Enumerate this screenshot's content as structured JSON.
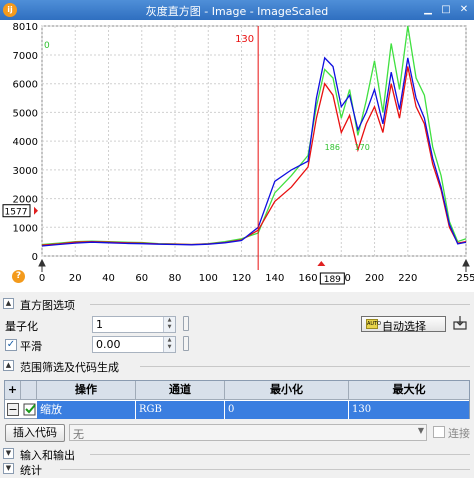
{
  "window": {
    "title": "灰度直方图 - Image - ImageScaled",
    "app_icon": "ImageJ-style orange circle icon",
    "controls": [
      "minimize-icon",
      "maximize-icon",
      "close-icon"
    ]
  },
  "chart_data": {
    "type": "line",
    "xlim": [
      0,
      255
    ],
    "ylim": [
      0,
      8010
    ],
    "x_ticks": [
      0,
      20,
      40,
      60,
      80,
      100,
      120,
      140,
      160,
      180,
      200,
      220,
      255
    ],
    "x_tick_labels": [
      "0",
      "20",
      "40",
      "60",
      "80",
      "100",
      "120",
      "140",
      "160",
      "189",
      "180",
      "200",
      "220",
      "255"
    ],
    "y_ticks": [
      0,
      1000,
      2000,
      3000,
      4000,
      5000,
      6000,
      7000,
      8010
    ],
    "y_tick_labels": [
      "0",
      "1000",
      "2000",
      "3000",
      "4000",
      "5000",
      "6000",
      "7000",
      "8010"
    ],
    "y_marker_value": "1577",
    "x_cursor_value": "189",
    "red_vline_x": 130,
    "red_vline_label": "130",
    "left_annotation": "0",
    "peak_annotations": [
      "186",
      "170"
    ],
    "grid": true,
    "colors": {
      "red": "#e81010",
      "green": "#40e040",
      "blue": "#1010e0",
      "marker_red": "#e02020"
    },
    "series": [
      {
        "color": "green",
        "x": [
          0,
          10,
          20,
          30,
          40,
          50,
          60,
          70,
          80,
          90,
          100,
          110,
          120,
          130,
          140,
          150,
          160,
          165,
          170,
          175,
          180,
          185,
          190,
          195,
          200,
          205,
          210,
          215,
          220,
          225,
          230,
          235,
          240,
          245,
          250,
          255
        ],
        "values": [
          400,
          450,
          500,
          520,
          500,
          480,
          470,
          430,
          420,
          400,
          430,
          500,
          600,
          800,
          2200,
          2800,
          3500,
          5200,
          6500,
          6200,
          4800,
          5800,
          4200,
          5400,
          6800,
          5000,
          7400,
          5800,
          8010,
          6200,
          5600,
          3800,
          2800,
          1200,
          500,
          600
        ]
      },
      {
        "color": "red",
        "x": [
          0,
          10,
          20,
          30,
          40,
          50,
          60,
          70,
          80,
          90,
          100,
          110,
          120,
          130,
          140,
          150,
          160,
          165,
          170,
          175,
          180,
          185,
          190,
          195,
          200,
          205,
          210,
          215,
          220,
          225,
          230,
          235,
          240,
          245,
          250,
          255
        ],
        "values": [
          380,
          420,
          480,
          500,
          480,
          460,
          450,
          420,
          410,
          400,
          420,
          470,
          560,
          900,
          1900,
          2400,
          3100,
          4800,
          6000,
          5600,
          4300,
          4900,
          3700,
          4600,
          5200,
          4300,
          6000,
          4800,
          6600,
          5200,
          4600,
          3200,
          2300,
          1000,
          450,
          500
        ]
      },
      {
        "color": "blue",
        "x": [
          0,
          10,
          20,
          30,
          40,
          50,
          60,
          70,
          80,
          90,
          100,
          110,
          120,
          130,
          140,
          150,
          160,
          165,
          170,
          175,
          180,
          185,
          190,
          195,
          200,
          205,
          210,
          215,
          220,
          225,
          230,
          235,
          240,
          245,
          250,
          255
        ],
        "values": [
          350,
          400,
          450,
          480,
          460,
          440,
          430,
          410,
          400,
          390,
          410,
          460,
          540,
          1000,
          2600,
          3000,
          3300,
          5500,
          6900,
          6600,
          5200,
          5600,
          4400,
          5000,
          5800,
          4600,
          6400,
          5100,
          6900,
          5500,
          4800,
          3400,
          2400,
          1100,
          420,
          480
        ]
      }
    ]
  },
  "icons": {
    "help": "help-icon",
    "left_cursor": "left-cursor-arrow-icon",
    "right_cursor": "right-cursor-arrow-icon",
    "top_marker": "top-marker-icon"
  },
  "histogram_options": {
    "section_label": "直方图选项",
    "quantize_label": "量子化",
    "quantize_value": "1",
    "smooth_label": "平滑",
    "smooth_checked": true,
    "smooth_value": "0.00",
    "auto_select_label": "自动选择",
    "auto_icon_text": "AUTO",
    "export_icon": "export-icon"
  },
  "filter_section": {
    "section_label": "范围筛选及代码生成",
    "table": {
      "add_button": "+",
      "remove_button": "−",
      "columns": [
        "操作",
        "通道",
        "最小化",
        "最大化"
      ],
      "rows": [
        {
          "checked": true,
          "operation": "缩放",
          "channel": "RGB",
          "min": "0",
          "max": "130"
        }
      ]
    },
    "insert_code_label": "插入代码",
    "insert_combo_value": "无",
    "link_label": "连接",
    "link_checked": false
  },
  "io_section": {
    "section_label": "输入和输出"
  },
  "stats_section": {
    "section_label": "统计"
  }
}
